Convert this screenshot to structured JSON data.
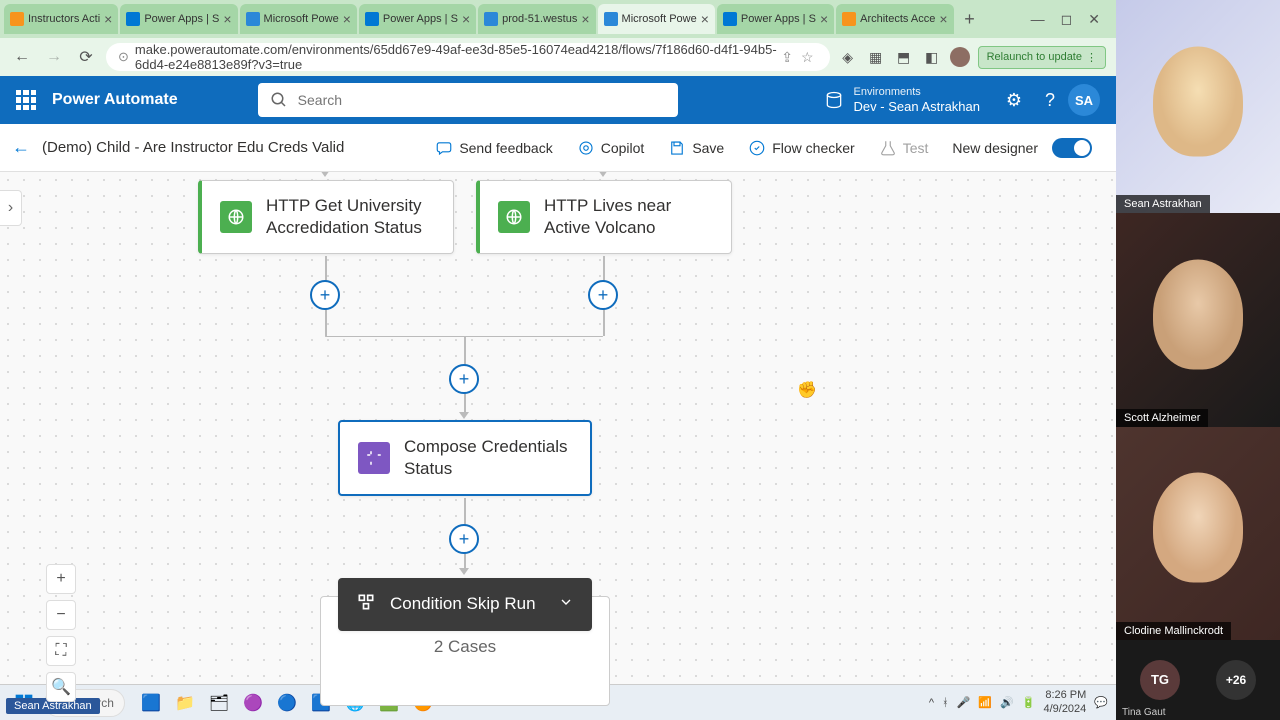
{
  "browser": {
    "tabs": [
      {
        "title": "Instructors Acti"
      },
      {
        "title": "Power Apps | S"
      },
      {
        "title": "Microsoft Powe"
      },
      {
        "title": "Power Apps | S"
      },
      {
        "title": "prod-51.westus"
      },
      {
        "title": "Microsoft Powe"
      },
      {
        "title": "Power Apps | S"
      },
      {
        "title": "Architects Acce"
      }
    ],
    "active_tab_index": 5,
    "url": "make.powerautomate.com/environments/65dd67e9-49af-ee3d-85e5-16074ead4218/flows/7f186d60-d4f1-94b5-6dd4-e24e8813e89f?v3=true",
    "relaunch_label": "Relaunch to update"
  },
  "header": {
    "app_title": "Power Automate",
    "search_placeholder": "Search",
    "env_label": "Environments",
    "env_name": "Dev - Sean Astrakhan",
    "user_initials": "SA"
  },
  "toolbar": {
    "flow_name": "(Demo) Child - Are Instructor Edu Creds Valid",
    "send_feedback": "Send feedback",
    "copilot": "Copilot",
    "save": "Save",
    "flow_checker": "Flow checker",
    "test": "Test",
    "new_designer": "New designer"
  },
  "flow": {
    "http1": "HTTP Get University Accredidation Status",
    "http2": "HTTP Lives near Active Volcano",
    "compose": "Compose Credentials Status",
    "condition": "Condition Skip Run",
    "cases_text": "2 Cases"
  },
  "taskbar": {
    "search_placeholder": "Search",
    "time": "8:26 PM",
    "date": "4/9/2024",
    "presenter": "Sean Astrakhan"
  },
  "video": {
    "participants": [
      {
        "name": "Sean Astrakhan"
      },
      {
        "name": "Scott Alzheimer"
      },
      {
        "name": "Clodine Mallinckrodt"
      }
    ],
    "extra_initials": "TG",
    "extra_name": "Tina Gaut",
    "overflow": "+26"
  }
}
